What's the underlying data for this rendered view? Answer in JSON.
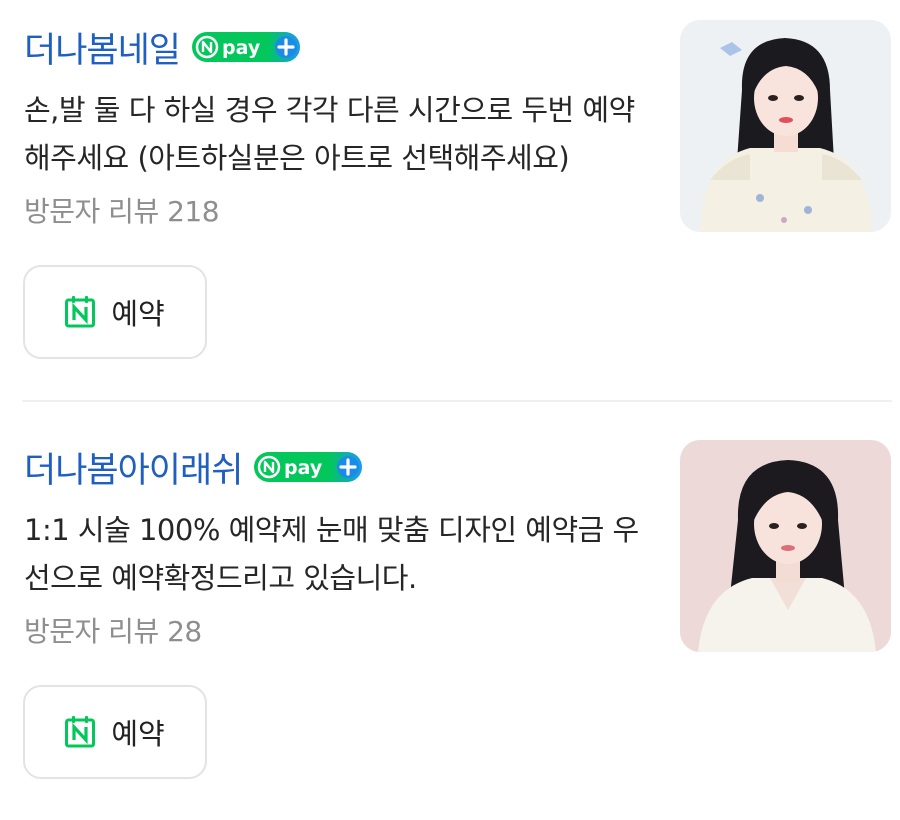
{
  "places": [
    {
      "name": "더나봄네일",
      "badge": "Npay+",
      "description": "손,발 둘 다 하실 경우 각각 다른 시간으로 두번 예약 해주세요 (아트하실분은 아트로 선택해주세요)",
      "reviews": "방문자 리뷰 218",
      "reserve_label": "예약",
      "thumbnail_bg": "#eef1f3"
    },
    {
      "name": "더나봄아이래쉬",
      "badge": "Npay+",
      "description": "1:1 시술 100% 예약제 눈매 맞춤 디자인 예약금 우선으로 예약확정드리고 있습니다.",
      "reviews": "방문자 리뷰 28",
      "reserve_label": "예약",
      "thumbnail_bg": "#ecd9d8"
    }
  ],
  "colors": {
    "title_blue": "#1f5fbf",
    "npay_green": "#03c75a",
    "reserve_icon_green": "#03c75a",
    "review_gray": "#8e8e8e"
  },
  "icons": {
    "badge": "npay-plus-icon",
    "reserve": "naver-calendar-icon"
  }
}
